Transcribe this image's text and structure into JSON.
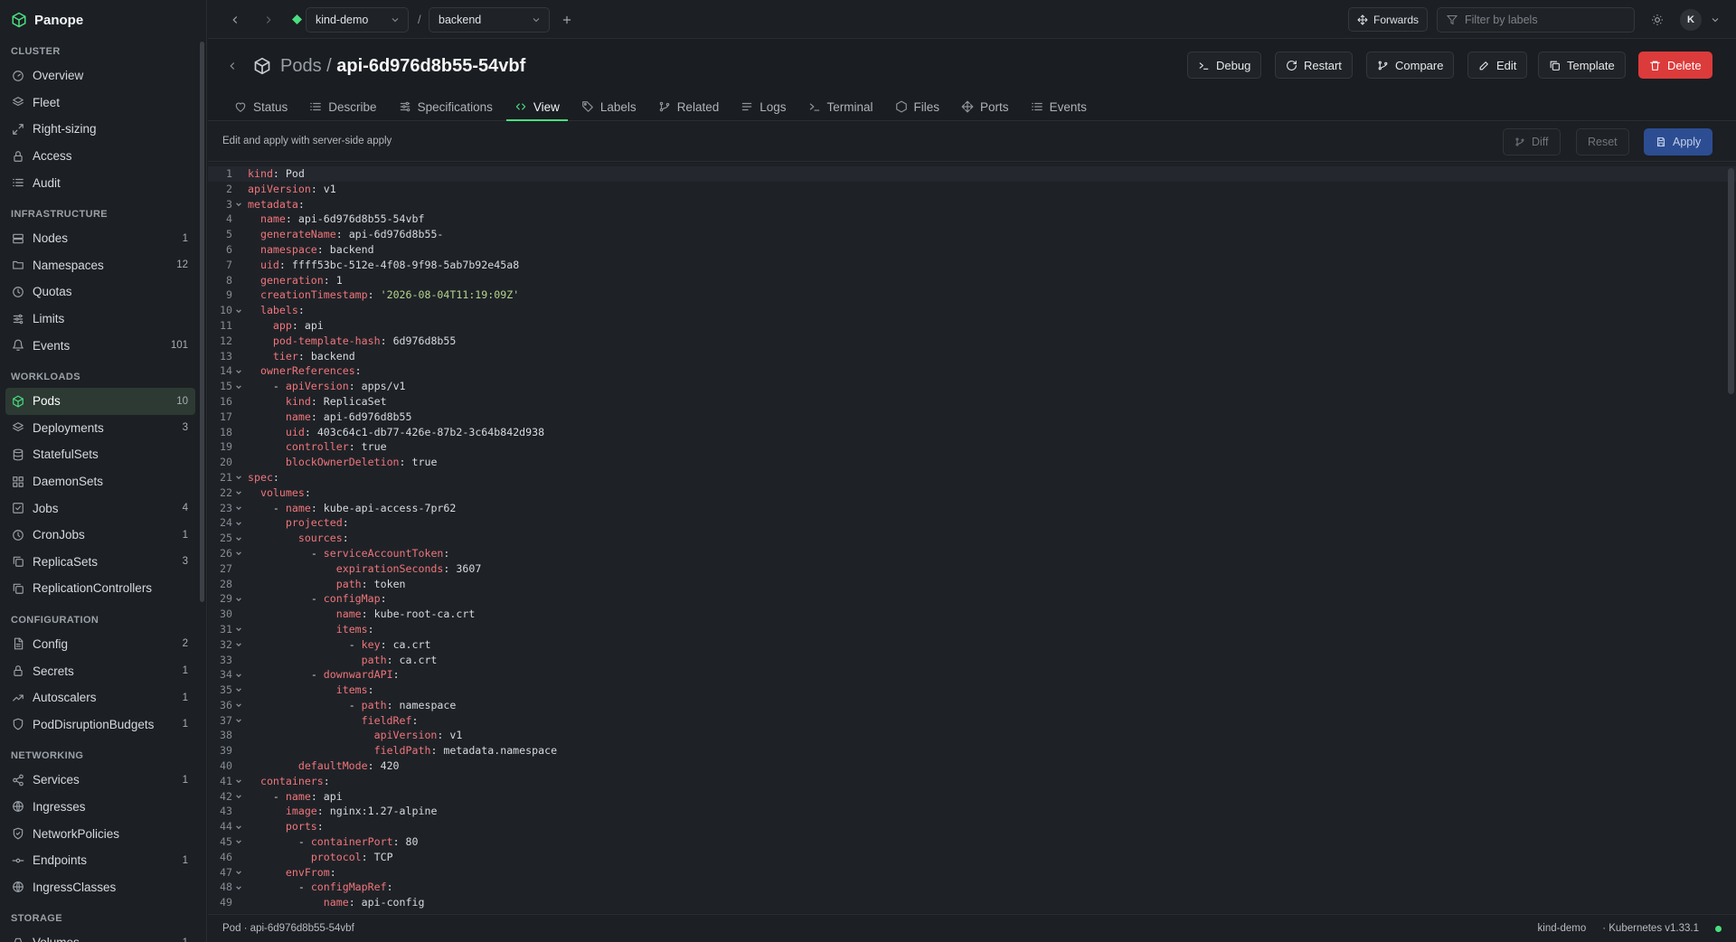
{
  "app": {
    "name": "Panope"
  },
  "sidebar": {
    "sections": [
      {
        "title": "CLUSTER",
        "items": [
          {
            "label": "Overview",
            "icon": "overview-icon",
            "count": ""
          },
          {
            "label": "Fleet",
            "icon": "layers-icon",
            "count": ""
          },
          {
            "label": "Right-sizing",
            "icon": "resize-icon",
            "count": ""
          },
          {
            "label": "Access",
            "icon": "lock-icon",
            "count": ""
          },
          {
            "label": "Audit",
            "icon": "list-icon",
            "count": ""
          }
        ]
      },
      {
        "title": "INFRASTRUCTURE",
        "items": [
          {
            "label": "Nodes",
            "icon": "server-icon",
            "count": "1"
          },
          {
            "label": "Namespaces",
            "icon": "folder-icon",
            "count": "12"
          },
          {
            "label": "Quotas",
            "icon": "gauge-icon",
            "count": ""
          },
          {
            "label": "Limits",
            "icon": "sliders-icon",
            "count": ""
          },
          {
            "label": "Events",
            "icon": "bell-icon",
            "count": "101"
          }
        ]
      },
      {
        "title": "WORKLOADS",
        "items": [
          {
            "label": "Pods",
            "icon": "cube-icon",
            "count": "10",
            "active": true
          },
          {
            "label": "Deployments",
            "icon": "layers-icon",
            "count": "3"
          },
          {
            "label": "StatefulSets",
            "icon": "database-icon",
            "count": ""
          },
          {
            "label": "DaemonSets",
            "icon": "grid-icon",
            "count": ""
          },
          {
            "label": "Jobs",
            "icon": "check-square-icon",
            "count": "4"
          },
          {
            "label": "CronJobs",
            "icon": "clock-icon",
            "count": "1"
          },
          {
            "label": "ReplicaSets",
            "icon": "copy-icon",
            "count": "3"
          },
          {
            "label": "ReplicationControllers",
            "icon": "copy-icon",
            "count": ""
          }
        ]
      },
      {
        "title": "CONFIGURATION",
        "items": [
          {
            "label": "Config",
            "icon": "file-icon",
            "count": "2"
          },
          {
            "label": "Secrets",
            "icon": "lock-icon",
            "count": "1"
          },
          {
            "label": "Autoscalers",
            "icon": "trend-icon",
            "count": "1"
          },
          {
            "label": "PodDisruptionBudgets",
            "icon": "shield-icon",
            "count": "1"
          }
        ]
      },
      {
        "title": "NETWORKING",
        "items": [
          {
            "label": "Services",
            "icon": "share-icon",
            "count": "1"
          },
          {
            "label": "Ingresses",
            "icon": "globe-icon",
            "count": ""
          },
          {
            "label": "NetworkPolicies",
            "icon": "shield-check-icon",
            "count": ""
          },
          {
            "label": "Endpoints",
            "icon": "endpoint-icon",
            "count": "1"
          },
          {
            "label": "IngressClasses",
            "icon": "globe-icon",
            "count": ""
          }
        ]
      },
      {
        "title": "STORAGE",
        "items": [
          {
            "label": "Volumes",
            "icon": "drive-icon",
            "count": "1"
          }
        ]
      }
    ]
  },
  "topbar": {
    "cluster": "kind-demo",
    "separator": "/",
    "namespace": "backend",
    "forwards_label": "Forwards",
    "filter_placeholder": "Filter by labels",
    "avatar_initial": "K"
  },
  "header": {
    "kind": "Pods",
    "separator": "/",
    "name": "api-6d976d8b55-54vbf",
    "actions": [
      {
        "label": "Debug",
        "icon": "terminal-icon"
      },
      {
        "label": "Restart",
        "icon": "refresh-icon"
      },
      {
        "label": "Compare",
        "icon": "git-branch-icon"
      },
      {
        "label": "Edit",
        "icon": "pencil-icon"
      },
      {
        "label": "Template",
        "icon": "copy-icon"
      },
      {
        "label": "Delete",
        "icon": "trash-icon",
        "danger": true
      }
    ],
    "tabs": [
      {
        "label": "Status",
        "icon": "heart-icon"
      },
      {
        "label": "Describe",
        "icon": "list-icon"
      },
      {
        "label": "Specifications",
        "icon": "sliders-icon"
      },
      {
        "label": "View",
        "icon": "code-icon",
        "active": true
      },
      {
        "label": "Labels",
        "icon": "tag-icon"
      },
      {
        "label": "Related",
        "icon": "git-branch-icon"
      },
      {
        "label": "Logs",
        "icon": "lines-icon"
      },
      {
        "label": "Terminal",
        "icon": "terminal-icon"
      },
      {
        "label": "Files",
        "icon": "hexagon-icon"
      },
      {
        "label": "Ports",
        "icon": "move-icon"
      },
      {
        "label": "Events",
        "icon": "list-icon"
      }
    ]
  },
  "editor": {
    "hint": "Edit and apply with server-side apply",
    "diff_label": "Diff",
    "reset_label": "Reset",
    "apply_label": "Apply",
    "lines": [
      {
        "n": "1",
        "indent": 0,
        "key": "kind",
        "value": "Pod"
      },
      {
        "n": "2",
        "indent": 0,
        "key": "apiVersion",
        "value": "v1"
      },
      {
        "n": "3",
        "indent": 0,
        "key": "metadata",
        "value": "",
        "fold": true
      },
      {
        "n": "4",
        "indent": 2,
        "key": "name",
        "value": "api-6d976d8b55-54vbf"
      },
      {
        "n": "5",
        "indent": 2,
        "key": "generateName",
        "value": "api-6d976d8b55-"
      },
      {
        "n": "6",
        "indent": 2,
        "key": "namespace",
        "value": "backend"
      },
      {
        "n": "7",
        "indent": 2,
        "key": "uid",
        "value": "ffff53bc-512e-4f08-9f98-5ab7b92e45a8"
      },
      {
        "n": "8",
        "indent": 2,
        "key": "generation",
        "value": "1"
      },
      {
        "n": "9",
        "indent": 2,
        "key": "creationTimestamp",
        "value": "'2026-08-04T11:19:09Z'",
        "string": true
      },
      {
        "n": "10",
        "indent": 2,
        "key": "labels",
        "value": "",
        "fold": true
      },
      {
        "n": "11",
        "indent": 4,
        "key": "app",
        "value": "api"
      },
      {
        "n": "12",
        "indent": 4,
        "key": "pod-template-hash",
        "value": "6d976d8b55"
      },
      {
        "n": "13",
        "indent": 4,
        "key": "tier",
        "value": "backend"
      },
      {
        "n": "14",
        "indent": 2,
        "key": "ownerReferences",
        "value": "",
        "fold": true
      },
      {
        "n": "15",
        "indent": 4,
        "dash": true,
        "key": "apiVersion",
        "value": "apps/v1",
        "fold": true
      },
      {
        "n": "16",
        "indent": 6,
        "key": "kind",
        "value": "ReplicaSet"
      },
      {
        "n": "17",
        "indent": 6,
        "key": "name",
        "value": "api-6d976d8b55"
      },
      {
        "n": "18",
        "indent": 6,
        "key": "uid",
        "value": "403c64c1-db77-426e-87b2-3c64b842d938"
      },
      {
        "n": "19",
        "indent": 6,
        "key": "controller",
        "value": "true"
      },
      {
        "n": "20",
        "indent": 6,
        "key": "blockOwnerDeletion",
        "value": "true"
      },
      {
        "n": "21",
        "indent": 0,
        "key": "spec",
        "value": "",
        "fold": true
      },
      {
        "n": "22",
        "indent": 2,
        "key": "volumes",
        "value": "",
        "fold": true
      },
      {
        "n": "23",
        "indent": 4,
        "dash": true,
        "key": "name",
        "value": "kube-api-access-7pr62",
        "fold": true
      },
      {
        "n": "24",
        "indent": 6,
        "key": "projected",
        "value": "",
        "fold": true
      },
      {
        "n": "25",
        "indent": 8,
        "key": "sources",
        "value": "",
        "fold": true
      },
      {
        "n": "26",
        "indent": 10,
        "dash": true,
        "key": "serviceAccountToken",
        "value": "",
        "fold": true
      },
      {
        "n": "27",
        "indent": 14,
        "key": "expirationSeconds",
        "value": "3607"
      },
      {
        "n": "28",
        "indent": 14,
        "key": "path",
        "value": "token"
      },
      {
        "n": "29",
        "indent": 10,
        "dash": true,
        "key": "configMap",
        "value": "",
        "fold": true
      },
      {
        "n": "30",
        "indent": 14,
        "key": "name",
        "value": "kube-root-ca.crt"
      },
      {
        "n": "31",
        "indent": 14,
        "key": "items",
        "value": "",
        "fold": true
      },
      {
        "n": "32",
        "indent": 16,
        "dash": true,
        "key": "key",
        "value": "ca.crt",
        "fold": true
      },
      {
        "n": "33",
        "indent": 18,
        "key": "path",
        "value": "ca.crt"
      },
      {
        "n": "34",
        "indent": 10,
        "dash": true,
        "key": "downwardAPI",
        "value": "",
        "fold": true
      },
      {
        "n": "35",
        "indent": 14,
        "key": "items",
        "value": "",
        "fold": true
      },
      {
        "n": "36",
        "indent": 16,
        "dash": true,
        "key": "path",
        "value": "namespace",
        "fold": true
      },
      {
        "n": "37",
        "indent": 18,
        "key": "fieldRef",
        "value": "",
        "fold": true
      },
      {
        "n": "38",
        "indent": 20,
        "key": "apiVersion",
        "value": "v1"
      },
      {
        "n": "39",
        "indent": 20,
        "key": "fieldPath",
        "value": "metadata.namespace"
      },
      {
        "n": "40",
        "indent": 8,
        "key": "defaultMode",
        "value": "420"
      },
      {
        "n": "41",
        "indent": 2,
        "key": "containers",
        "value": "",
        "fold": true
      },
      {
        "n": "42",
        "indent": 4,
        "dash": true,
        "key": "name",
        "value": "api",
        "fold": true
      },
      {
        "n": "43",
        "indent": 6,
        "key": "image",
        "value": "nginx:1.27-alpine"
      },
      {
        "n": "44",
        "indent": 6,
        "key": "ports",
        "value": "",
        "fold": true
      },
      {
        "n": "45",
        "indent": 8,
        "dash": true,
        "key": "containerPort",
        "value": "80",
        "fold": true
      },
      {
        "n": "46",
        "indent": 10,
        "key": "protocol",
        "value": "TCP"
      },
      {
        "n": "47",
        "indent": 6,
        "key": "envFrom",
        "value": "",
        "fold": true
      },
      {
        "n": "48",
        "indent": 8,
        "dash": true,
        "key": "configMapRef",
        "value": "",
        "fold": true
      },
      {
        "n": "49",
        "indent": 12,
        "key": "name",
        "value": "api-config"
      }
    ]
  },
  "statusbar": {
    "left": "Pod · api-6d976d8b55-54vbf",
    "cluster": "kind-demo",
    "version": "· Kubernetes v1.33.1"
  },
  "colors": {
    "accent": "#4ade80",
    "danger": "#dc3b3b",
    "apply": "#2c4d92",
    "yaml_key": "#f0757a",
    "yaml_string": "#b5d48a"
  }
}
